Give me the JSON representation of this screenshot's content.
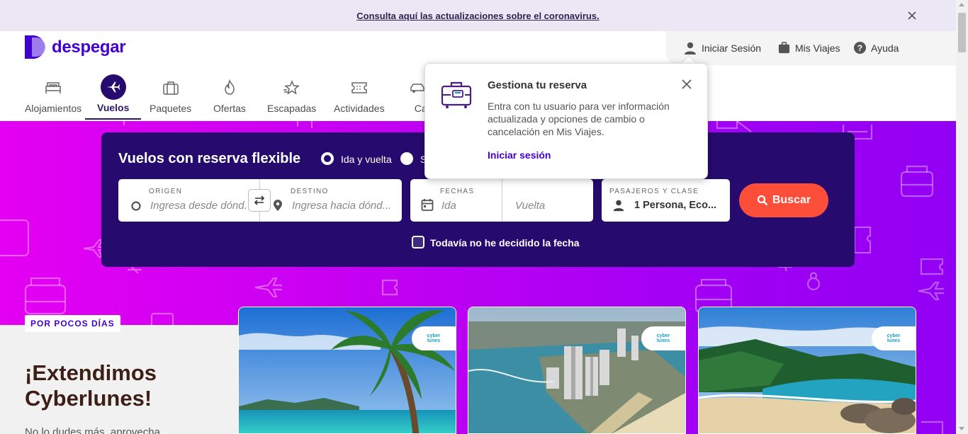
{
  "banner": {
    "text": "Consulta aquí las actualizaciones sobre el coronavirus."
  },
  "header": {
    "logo_text": "despegar",
    "login_label": "Iniciar Sesión",
    "trips_label": "Mis Viajes",
    "help_label": "Ayuda"
  },
  "nav": {
    "items": [
      {
        "label": "Alojamientos",
        "icon": "bed-icon"
      },
      {
        "label": "Vuelos",
        "icon": "plane-icon",
        "active": true
      },
      {
        "label": "Paquetes",
        "icon": "suitcase-icon"
      },
      {
        "label": "Ofertas",
        "icon": "fire-icon"
      },
      {
        "label": "Escapadas",
        "icon": "star-plane-icon"
      },
      {
        "label": "Actividades",
        "icon": "ticket-icon"
      },
      {
        "label": "Car",
        "icon": "car-icon"
      }
    ]
  },
  "search": {
    "title": "Vuelos con reserva flexible",
    "radio_roundtrip": "Ida y vuelta",
    "radio_oneway_partial": "S",
    "origin_caption": "ORIGEN",
    "origin_placeholder": "Ingresa desde dónd...",
    "destination_caption": "DESTINO",
    "destination_placeholder": "Ingresa hacia dónd...",
    "dates_caption": "FECHAS",
    "depart_placeholder": "Ida",
    "return_placeholder": "Vuelta",
    "passengers_caption": "PASAJEROS Y CLASE",
    "passengers_value": "1 Persona, Eco...",
    "search_button": "Buscar",
    "undecided_label": "Todavía no he decidido la fecha"
  },
  "popover": {
    "title": "Gestiona tu reserva",
    "body": "Entra con tu usuario para ver información actualizada y opciones de cambio o cancelación en Mis Viajes.",
    "link": "Iniciar sesión"
  },
  "promo": {
    "tag": "POR POCOS DÍAS",
    "title": "¡Extendimos Cyberlunes!",
    "text": "No lo dudes más, aprovecha",
    "badge_line1": "cyber",
    "badge_line2": "lunes"
  },
  "colors": {
    "brand": "#4300d2",
    "search_bg": "#260a6e",
    "cta": "#fd4e3a",
    "hero_start": "#e400f2",
    "hero_end": "#9200f3"
  }
}
